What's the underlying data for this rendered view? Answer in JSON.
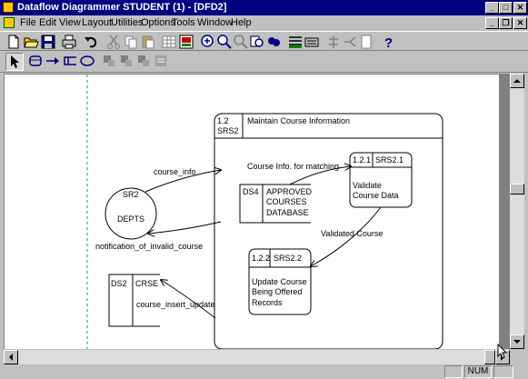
{
  "window": {
    "title": "Dataflow Diagrammer STUDENT (1) - [DFD2]",
    "minimize": "_",
    "maximize": "□",
    "close": "✕"
  },
  "menu": {
    "items": [
      "File",
      "Edit",
      "View",
      "Layout",
      "Utilities",
      "Options",
      "Tools",
      "Window",
      "Help"
    ],
    "child_minimize": "_",
    "child_restore": "❐",
    "child_close": "✕"
  },
  "diagram": {
    "external_entity": {
      "id": "SR2",
      "name": "DEPTS"
    },
    "process_parent": {
      "number": "1.2",
      "id": "SRS2",
      "name": "Maintain Course Information"
    },
    "process_validate": {
      "number": "1.2.1",
      "id": "SRS2.1",
      "name_line1": "Validate",
      "name_line2": "Course Data"
    },
    "process_update": {
      "number": "1.2.2",
      "id": "SRS2.2",
      "name_line1": "Update Course",
      "name_line2": "Being Offered",
      "name_line3": "Records"
    },
    "datastore_ds4": {
      "id": "DS4",
      "name_line1": "APPROVED",
      "name_line2": "COURSES",
      "name_line3": "DATABASE"
    },
    "datastore_ds2": {
      "id": "DS2",
      "name": "CRSE"
    },
    "flows": {
      "course_info": "course_info",
      "invalid": "notification_of_invalid_course",
      "matching": "Course Info. for matching",
      "validated": "Validated Course",
      "insert_update": "course_insert_update"
    }
  },
  "status": {
    "num": "NUM"
  },
  "icons": {
    "toolbar1": [
      "new-icon",
      "open-icon",
      "save-icon",
      "print-icon",
      "undo-icon",
      "cut-icon",
      "copy-icon",
      "paste-icon",
      "grid-icon",
      "image-icon",
      "zoom-in-icon",
      "zoom-out-icon",
      "zoom-fit-icon",
      "find-icon",
      "find-next-icon",
      "align-icon",
      "properties-icon",
      "connect-icon",
      "split-icon",
      "page-icon",
      "help-icon"
    ],
    "toolbar2": [
      "pointer-icon",
      "process-tool-icon",
      "flow-tool-icon",
      "datastore-tool-icon",
      "entity-tool-icon",
      "explode-icon",
      "implode-icon",
      "level-up-icon",
      "annotate-icon"
    ]
  }
}
